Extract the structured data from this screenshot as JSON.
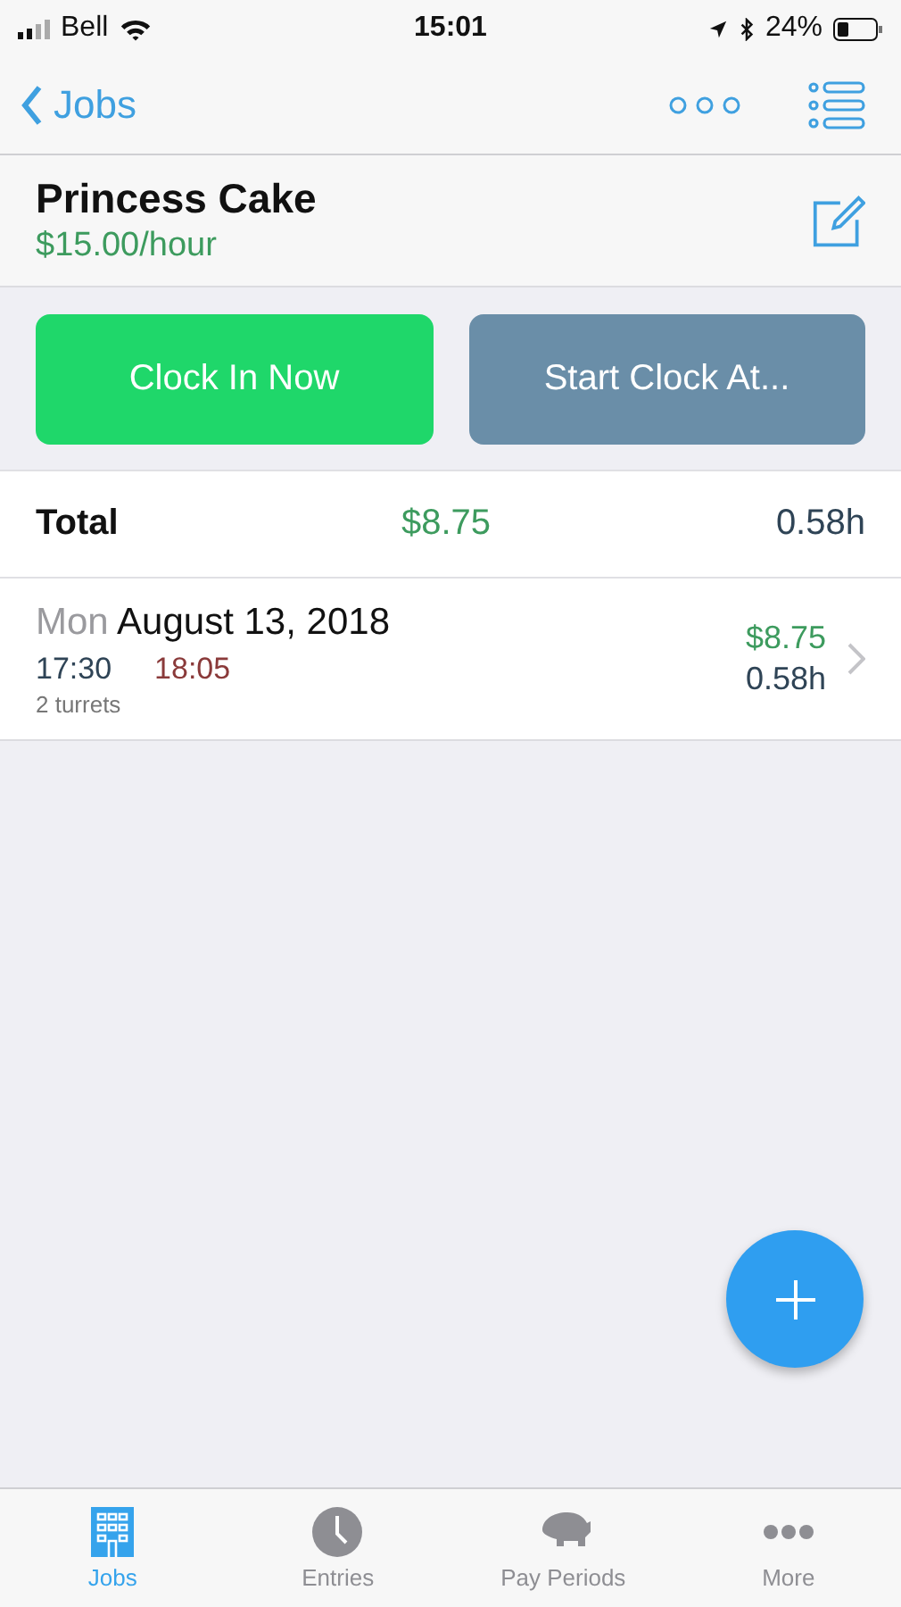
{
  "status_bar": {
    "carrier": "Bell",
    "time": "15:01",
    "battery": "24%"
  },
  "nav": {
    "back": "Jobs"
  },
  "job": {
    "name": "Princess Cake",
    "rate": "$15.00/hour"
  },
  "actions": [
    "Clock In Now",
    "Start Clock At..."
  ],
  "total": {
    "label": "Total",
    "amount": "$8.75",
    "hours": "0.58h"
  },
  "entries": [
    {
      "weekday": "Mon",
      "date": "August 13, 2018",
      "start": "17:30",
      "end": "18:05",
      "note": "2 turrets",
      "amount": "$8.75",
      "hours": "0.58h"
    }
  ],
  "tabs": [
    {
      "label": "Jobs",
      "selected": true
    },
    {
      "label": "Entries",
      "selected": false
    },
    {
      "label": "Pay Periods",
      "selected": false
    },
    {
      "label": "More",
      "selected": false
    }
  ]
}
